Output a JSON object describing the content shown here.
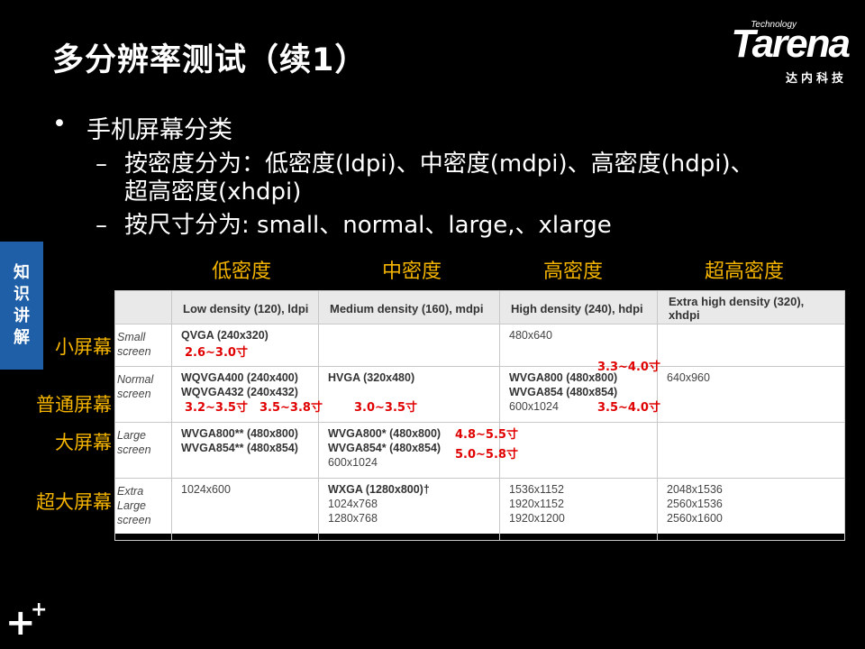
{
  "title": "多分辨率测试（续1）",
  "logo": {
    "technology": "Technology",
    "brand": "Tarena",
    "cn": "达内科技"
  },
  "side_tab": [
    "知",
    "识",
    "讲",
    "解"
  ],
  "bullets": {
    "main": "手机屏幕分类",
    "sub1_line1": "按密度分为：低密度(ldpi)、中密度(mdpi)、高密度(hdpi)、",
    "sub1_line2": "超高密度(xhdpi)",
    "sub2": "按尺寸分为: small、normal、large,、xlarge"
  },
  "col_labels": [
    "低密度",
    "中密度",
    "高密度",
    "超高密度"
  ],
  "row_labels": [
    "小屏幕",
    "普通屏幕",
    "大屏幕",
    "超大屏幕"
  ],
  "table": {
    "headers": [
      "Low density (120), ldpi",
      "Medium density (160), mdpi",
      "High density (240), hdpi",
      "Extra high density (320), xhdpi"
    ],
    "rows": [
      {
        "label": [
          "Small",
          "screen"
        ],
        "cells": [
          [
            "QVGA (240x320)"
          ],
          [],
          [
            "480x640"
          ],
          []
        ]
      },
      {
        "label": [
          "Normal",
          "screen"
        ],
        "cells": [
          [
            "WQVGA400 (240x400)",
            "WQVGA432 (240x432)"
          ],
          [
            "HVGA (320x480)"
          ],
          [
            "WVGA800 (480x800)",
            "WVGA854 (480x854)",
            "600x1024"
          ],
          [
            "640x960"
          ]
        ]
      },
      {
        "label": [
          "Large",
          "screen"
        ],
        "cells": [
          [
            "WVGA800** (480x800)",
            "WVGA854** (480x854)"
          ],
          [
            "WVGA800* (480x800)",
            "WVGA854* (480x854)",
            "600x1024"
          ],
          [],
          []
        ]
      },
      {
        "label": [
          "Extra",
          "Large",
          "screen"
        ],
        "cells": [
          [
            "1024x600"
          ],
          [
            "WXGA (1280x800)†",
            "1024x768",
            "1280x768"
          ],
          [
            "1536x1152",
            "1920x1152",
            "1920x1200"
          ],
          [
            "2048x1536",
            "2560x1536",
            "2560x1600"
          ]
        ]
      }
    ]
  },
  "annotations": {
    "a1": "2.6~3.0寸",
    "a2": "3.3~4.0寸",
    "a3": "3.2~3.5寸",
    "a4": "3.5~3.8寸",
    "a5": "3.0~3.5寸",
    "a6": "3.5~4.0寸",
    "a7": "4.8~5.5寸",
    "a8": "5.0~5.8寸"
  },
  "footer_icon": "plus-plus-icon"
}
